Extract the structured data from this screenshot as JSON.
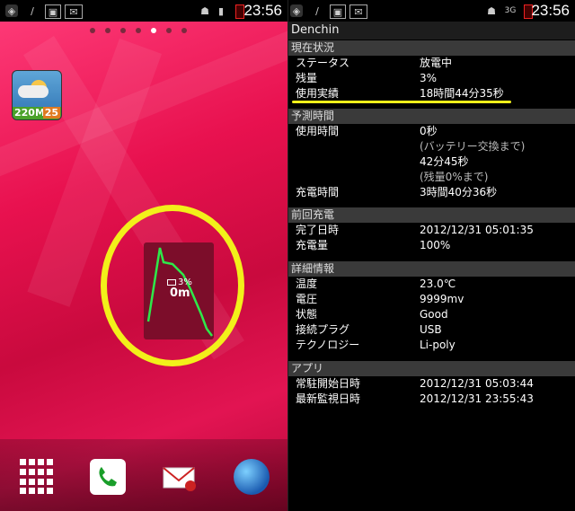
{
  "left": {
    "status": {
      "time": "23:56"
    },
    "weather_widget": {
      "altitude": "220M",
      "temperature": "25"
    },
    "battery_widget": {
      "percent": "3%",
      "remaining": "0m"
    }
  },
  "right": {
    "status": {
      "time": "23:56",
      "network": "3G"
    },
    "app_title": "Denchin",
    "sections": [
      {
        "title": "現在状況",
        "rows": [
          {
            "key": "ステータス",
            "value": "放電中"
          },
          {
            "key": "残量",
            "value": "3%"
          },
          {
            "key": "使用実績",
            "value": "18時間44分35秒"
          }
        ]
      },
      {
        "title": "予測時間",
        "rows": [
          {
            "key": "使用時間",
            "value": "0秒"
          },
          {
            "key": "",
            "value": "(バッテリー交換まで)"
          },
          {
            "key": "",
            "value": "42分45秒"
          },
          {
            "key": "",
            "value": "(残量0%まで)"
          },
          {
            "key": "充電時間",
            "value": "3時間40分36秒"
          }
        ]
      },
      {
        "title": "前回充電",
        "rows": [
          {
            "key": "完了日時",
            "value": "2012/12/31 05:01:35"
          },
          {
            "key": "充電量",
            "value": "100%"
          }
        ]
      },
      {
        "title": "詳細情報",
        "rows": [
          {
            "key": "温度",
            "value": "23.0℃"
          },
          {
            "key": "電圧",
            "value": "9999mv"
          },
          {
            "key": "状態",
            "value": "Good"
          },
          {
            "key": "接続プラグ",
            "value": "USB"
          },
          {
            "key": "テクノロジー",
            "value": "Li-poly"
          }
        ]
      },
      {
        "title": "アプリ",
        "rows": [
          {
            "key": "常駐開始日時",
            "value": "2012/12/31 05:03:44"
          },
          {
            "key": "最新監視日時",
            "value": "2012/12/31 23:55:43"
          }
        ]
      }
    ]
  },
  "colors": {
    "highlight": "#f2f01a",
    "graph_line": "#2ee84a",
    "section_bg": "#3a3a3a"
  }
}
